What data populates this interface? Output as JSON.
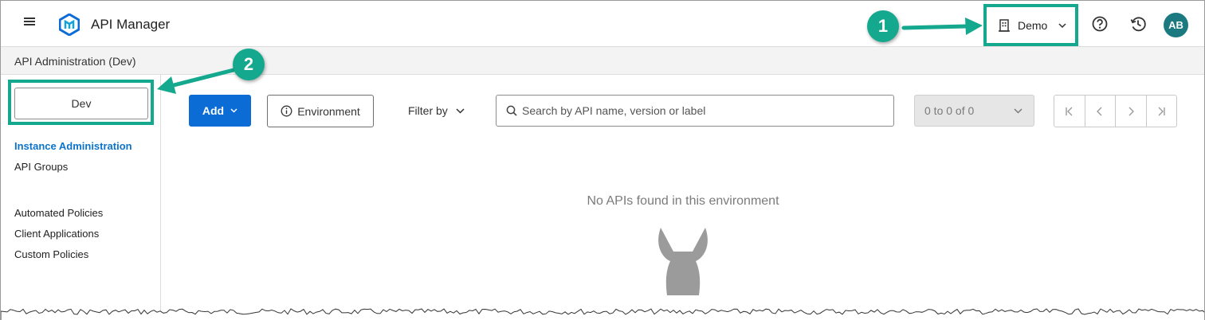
{
  "header": {
    "app_title": "API Manager",
    "org_selector": {
      "label": "Demo",
      "icon": "building-icon"
    },
    "help_icon": "help-icon",
    "history_icon": "history-icon",
    "avatar_initials": "AB"
  },
  "breadcrumb": "API Administration (Dev)",
  "sidebar": {
    "environment_button": "Dev",
    "items": [
      {
        "label": "Instance Administration",
        "active": true
      },
      {
        "label": "API Groups",
        "active": false
      },
      {
        "label": "Automated Policies",
        "active": false
      },
      {
        "label": "Client Applications",
        "active": false
      },
      {
        "label": "Custom Policies",
        "active": false
      }
    ]
  },
  "toolbar": {
    "add_label": "Add",
    "environment_label": "Environment",
    "filter_label": "Filter by",
    "search_placeholder": "Search by API name, version or label",
    "range_label": "0 to 0 of 0"
  },
  "main": {
    "empty_message": "No APIs found in this environment"
  },
  "annotations": [
    {
      "number": "1"
    },
    {
      "number": "2"
    }
  ],
  "colors": {
    "accent_blue": "#0b6cd6",
    "annotation_green": "#14a98e",
    "avatar_teal": "#1b7a80"
  }
}
